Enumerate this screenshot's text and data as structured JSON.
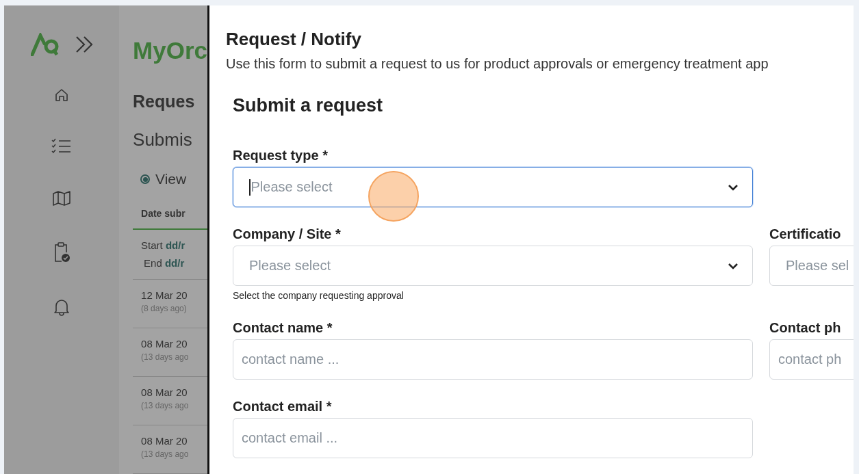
{
  "app": {
    "title": "MyOrc",
    "heading": "Reques",
    "subheading": "Submis",
    "view_option": {
      "label": "View",
      "selected": true
    },
    "table": {
      "columns": [
        "Date subr"
      ],
      "filter": {
        "start_label": "Start",
        "start_value": "dd/r",
        "end_label": "End",
        "end_value": "dd/r"
      },
      "rows": [
        {
          "date": "12 Mar 20",
          "ago": "(8 days ago)"
        },
        {
          "date": "08 Mar 20",
          "ago": "(13 days ago"
        },
        {
          "date": "08 Mar 20",
          "ago": "(13 days ago"
        },
        {
          "date": "08 Mar 20",
          "ago": "(13 days ago"
        }
      ]
    }
  },
  "panel": {
    "title": "Request / Notify",
    "description": "Use this form to submit a request to us for product approvals or emergency treatment app",
    "card": {
      "title": "Submit a request",
      "rows": [
        {
          "fields": [
            {
              "kind": "select",
              "label": "Request type *",
              "placeholder": "Please select",
              "focused": true
            }
          ]
        },
        {
          "fields": [
            {
              "kind": "select",
              "label": "Company / Site *",
              "placeholder": "Please select",
              "focused": false,
              "hint": "Select the company requesting approval"
            },
            {
              "kind": "select",
              "label": "Certificatio",
              "placeholder": "Please sel",
              "focused": false
            }
          ]
        },
        {
          "fields": [
            {
              "kind": "text",
              "label": "Contact name *",
              "placeholder": "contact name ...",
              "focused": false
            },
            {
              "kind": "text",
              "label": "Contact ph",
              "placeholder": "contact ph",
              "focused": false
            }
          ]
        },
        {
          "fields": [
            {
              "kind": "text",
              "label": "Contact email *",
              "placeholder": "contact email ...",
              "focused": false
            }
          ]
        }
      ]
    }
  }
}
